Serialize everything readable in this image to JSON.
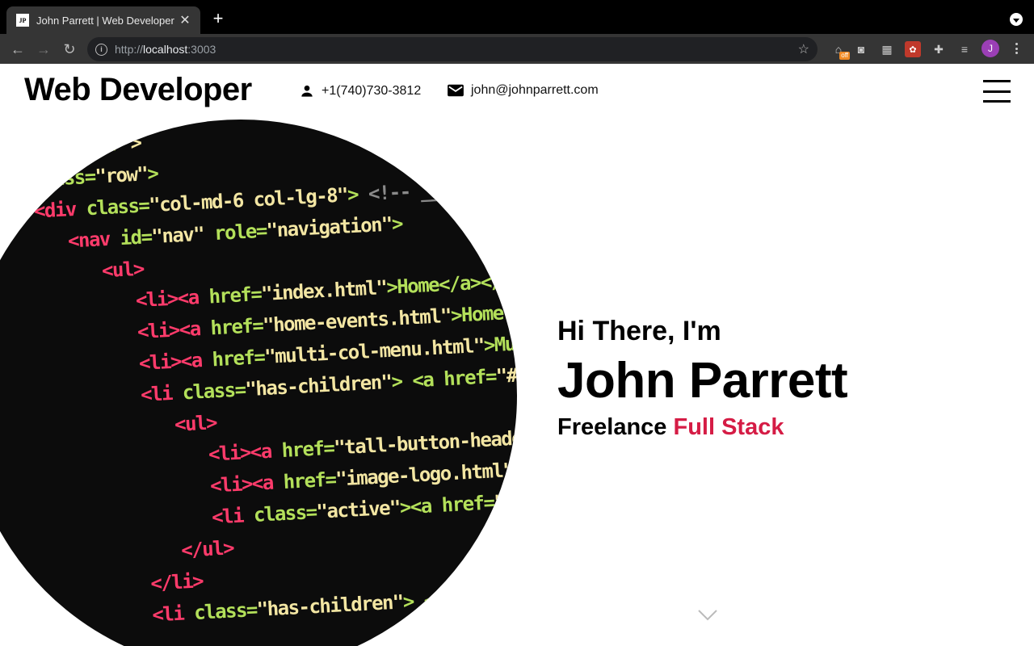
{
  "browser": {
    "tab_title": "John Parrett | Web Developer",
    "favicon_text": "JP",
    "url_scheme": "http://",
    "url_host": "localhost",
    "url_port": ":3003",
    "extension_badge": "off",
    "profile_initial": "J"
  },
  "header": {
    "brand": "Web Developer",
    "phone": "+1(740)730-3812",
    "email": "john@johnparrett.com"
  },
  "hero": {
    "greeting": "Hi There, I'm",
    "name": "John Parrett",
    "role_prefix": "Freelance",
    "role_accent": "Full Stack",
    "accent_color": "#d51c45"
  },
  "code_lines": [
    [
      "",
      "ntainer\">"
    ],
    [
      "",
      "class=\"row\">"
    ],
    [
      "<div",
      " class=\"col-md-6 col-lg-8\">",
      " <!-- ______ BEGIN NAV"
    ],
    [
      "<nav",
      " id=\"nav\" role=\"navigation\">"
    ],
    [
      "<ul>",
      ""
    ],
    [
      "<li><a",
      " href=\"index.html\">Home</a></li>"
    ],
    [
      "<li><a",
      " href=\"home-events.html\">Home Events</a></li>"
    ],
    [
      "<li><a",
      " href=\"multi-col-menu.html\">Multiple Column Men"
    ],
    [
      "<li",
      " class=\"has-children\"> <a href=\"#\" class=\"current\">"
    ],
    [
      "<ul>",
      ""
    ],
    [
      "<li><a",
      " href=\"tall-button-header.html\">Tall Bu"
    ],
    [
      "<li><a",
      " href=\"image-logo.html\">Image Logo</a>"
    ],
    [
      "<li",
      " class=\"active\"><a href=\"tall-logo.html"
    ],
    [
      "</ul>",
      ""
    ],
    [
      "</li>",
      ""
    ],
    [
      "<li",
      " class=\"has-children\"> <a href=\"#\">Care"
    ]
  ]
}
